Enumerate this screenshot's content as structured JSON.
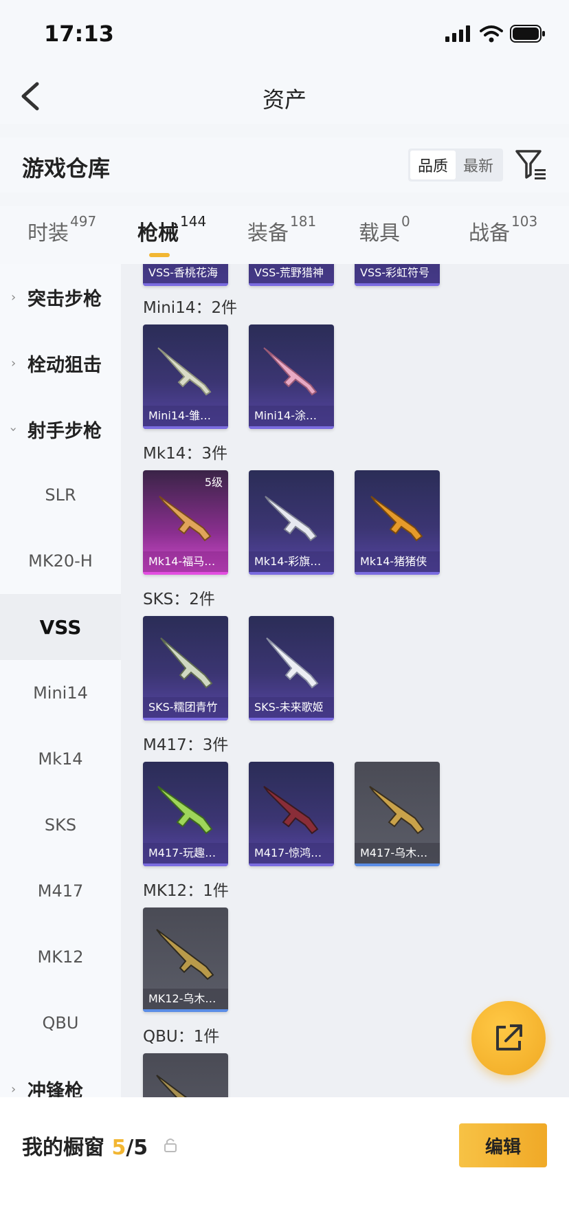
{
  "status_bar": {
    "time": "17:13"
  },
  "nav": {
    "title": "资产"
  },
  "section": {
    "title": "游戏仓库",
    "sort_options": [
      "品质",
      "最新"
    ],
    "active_sort": "品质"
  },
  "tabs": [
    {
      "label": "时装",
      "count": "497"
    },
    {
      "label": "枪械",
      "count": "144"
    },
    {
      "label": "装备",
      "count": "181"
    },
    {
      "label": "载具",
      "count": "0"
    },
    {
      "label": "战备",
      "count": "103"
    }
  ],
  "active_tab": "枪械",
  "sidebar": {
    "categories": {
      "assault": "突击步枪",
      "bolt": "栓动狙击",
      "marksman": "射手步枪",
      "smg": "冲锋枪"
    },
    "marksman_items": [
      "SLR",
      "MK20-H",
      "VSS",
      "Mini14",
      "Mk14",
      "SKS",
      "M417",
      "MK12",
      "QBU"
    ],
    "selected": "VSS"
  },
  "groups": {
    "vss_partial": [
      "VSS-香桃花海",
      "VSS-荒野猎神",
      "VSS-彩虹符号"
    ],
    "mini14": {
      "label": "Mini14：2件",
      "items": [
        "Mini14-雏…",
        "Mini14-涂…"
      ]
    },
    "mk14": {
      "label": "Mk14：3件",
      "items": [
        "Mk14-福马…",
        "Mk14-彩旗…",
        "Mk14-猪猪侠"
      ],
      "level_badge": "5级"
    },
    "sks": {
      "label": "SKS：2件",
      "items": [
        "SKS-糯团青竹",
        "SKS-未来歌姬"
      ]
    },
    "m417": {
      "label": "M417：3件",
      "items": [
        "M417-玩趣…",
        "M417-惊鸿…",
        "M417-乌木…"
      ]
    },
    "mk12": {
      "label": "MK12：1件",
      "items": [
        "MK12-乌木…"
      ]
    },
    "qbu": {
      "label": "QBU：1件"
    }
  },
  "footer": {
    "label": "我的橱窗",
    "count_current": "5",
    "count_total": "/5",
    "edit_label": "编辑"
  },
  "colors": {
    "accent": "#f2b632",
    "card_purple": "#3b3572",
    "card_pink": "#d34ed0",
    "card_gray": "#5b5d68"
  }
}
